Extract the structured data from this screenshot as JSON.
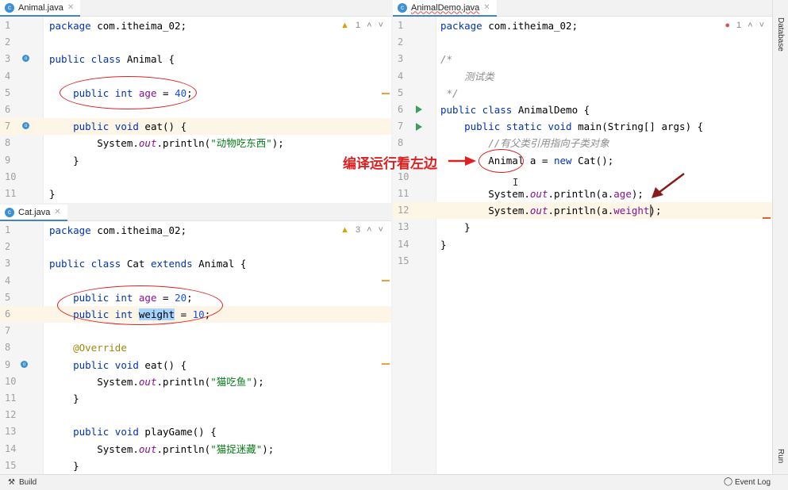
{
  "colors": {
    "keyword": "#0033b3",
    "field": "#871094",
    "number": "#1750eb",
    "string": "#067d17",
    "annotation_red": "#e02020"
  },
  "panes": {
    "animal": {
      "tab": "Animal.java",
      "inspection": "1",
      "inspection_icon": "warning-icon",
      "highlight": [
        7
      ],
      "lines": [
        [
          [
            "kw",
            "package"
          ],
          [
            "p",
            " com.itheima_02;"
          ]
        ],
        [],
        [
          [
            "kw",
            "public class"
          ],
          [
            "p",
            " Animal {"
          ]
        ],
        [],
        [
          [
            "p",
            "    "
          ],
          [
            "kw",
            "public int"
          ],
          [
            "p",
            " "
          ],
          [
            "field",
            "age"
          ],
          [
            "p",
            " = "
          ],
          [
            "num",
            "40"
          ],
          [
            "p",
            ";"
          ]
        ],
        [],
        [
          [
            "p",
            "    "
          ],
          [
            "kw",
            "public void"
          ],
          [
            "p",
            " eat() {"
          ]
        ],
        [
          [
            "p",
            "        System."
          ],
          [
            "it",
            "out"
          ],
          [
            "p",
            ".println("
          ],
          [
            "str",
            "\"动物吃东西\""
          ],
          [
            "p",
            ");"
          ]
        ],
        [
          [
            "p",
            "    }"
          ]
        ],
        [],
        [
          [
            "p",
            "}"
          ]
        ]
      ]
    },
    "cat": {
      "tab": "Cat.java",
      "inspection": "3",
      "inspection_icon": "warning-icon",
      "highlight": [
        6
      ],
      "lines": [
        [
          [
            "kw",
            "package"
          ],
          [
            "p",
            " com.itheima_02;"
          ]
        ],
        [],
        [
          [
            "kw",
            "public class"
          ],
          [
            "p",
            " Cat "
          ],
          [
            "kw",
            "extends"
          ],
          [
            "p",
            " Animal {"
          ]
        ],
        [],
        [
          [
            "p",
            "    "
          ],
          [
            "kw",
            "public int"
          ],
          [
            "p",
            " "
          ],
          [
            "field",
            "age"
          ],
          [
            "p",
            " = "
          ],
          [
            "num",
            "20"
          ],
          [
            "p",
            ";"
          ]
        ],
        [
          [
            "p",
            "    "
          ],
          [
            "kw",
            "public int"
          ],
          [
            "p",
            " "
          ],
          [
            "sel",
            "weight"
          ],
          [
            "p",
            " = "
          ],
          [
            "num",
            "10"
          ],
          [
            "p",
            ";"
          ]
        ],
        [],
        [
          [
            "p",
            "    "
          ],
          [
            "an",
            "@Override"
          ]
        ],
        [
          [
            "p",
            "    "
          ],
          [
            "kw",
            "public void"
          ],
          [
            "p",
            " eat() {"
          ]
        ],
        [
          [
            "p",
            "        System."
          ],
          [
            "it",
            "out"
          ],
          [
            "p",
            ".println("
          ],
          [
            "str",
            "\"猫吃鱼\""
          ],
          [
            "p",
            ");"
          ]
        ],
        [
          [
            "p",
            "    }"
          ]
        ],
        [],
        [
          [
            "p",
            "    "
          ],
          [
            "kw",
            "public void"
          ],
          [
            "p",
            " playGame() {"
          ]
        ],
        [
          [
            "p",
            "        System."
          ],
          [
            "it",
            "out"
          ],
          [
            "p",
            ".println("
          ],
          [
            "str",
            "\"猫捉迷藏\""
          ],
          [
            "p",
            ");"
          ]
        ],
        [
          [
            "p",
            "    }"
          ]
        ]
      ]
    },
    "demo": {
      "tab": "AnimalDemo.java",
      "inspection": "1",
      "inspection_icon": "error-icon",
      "highlight": [
        12
      ],
      "lines": [
        [
          [
            "kw",
            "package"
          ],
          [
            "p",
            " com.itheima_02;"
          ]
        ],
        [],
        [
          [
            "cm",
            "/*"
          ]
        ],
        [
          [
            "cm",
            "    测试类"
          ]
        ],
        [
          [
            "cm",
            " */"
          ]
        ],
        [
          [
            "kw",
            "public class"
          ],
          [
            "p",
            " AnimalDemo {"
          ]
        ],
        [
          [
            "p",
            "    "
          ],
          [
            "kw",
            "public static void"
          ],
          [
            "p",
            " main(String[] args) {"
          ]
        ],
        [
          [
            "p",
            "        "
          ],
          [
            "cm",
            "//有父类引用指向子类对象"
          ]
        ],
        [
          [
            "p",
            "        Animal a = "
          ],
          [
            "kw",
            "new"
          ],
          [
            "p",
            " Cat();"
          ]
        ],
        [],
        [
          [
            "p",
            "        System."
          ],
          [
            "it",
            "out"
          ],
          [
            "p",
            ".println(a."
          ],
          [
            "field",
            "age"
          ],
          [
            "p",
            ");"
          ]
        ],
        [
          [
            "p",
            "        System."
          ],
          [
            "it",
            "out"
          ],
          [
            "p",
            ".println(a."
          ],
          [
            "field",
            "weight"
          ],
          [
            "p",
            ");"
          ]
        ],
        [
          [
            "p",
            "    }"
          ]
        ],
        [
          [
            "p",
            "}"
          ]
        ],
        []
      ]
    }
  },
  "annotation": {
    "text": "编译运行看左边"
  },
  "sidebar": {
    "database": "Database",
    "run": "Run"
  },
  "statusbar": {
    "build": "Build",
    "event_log": "Event Log"
  }
}
